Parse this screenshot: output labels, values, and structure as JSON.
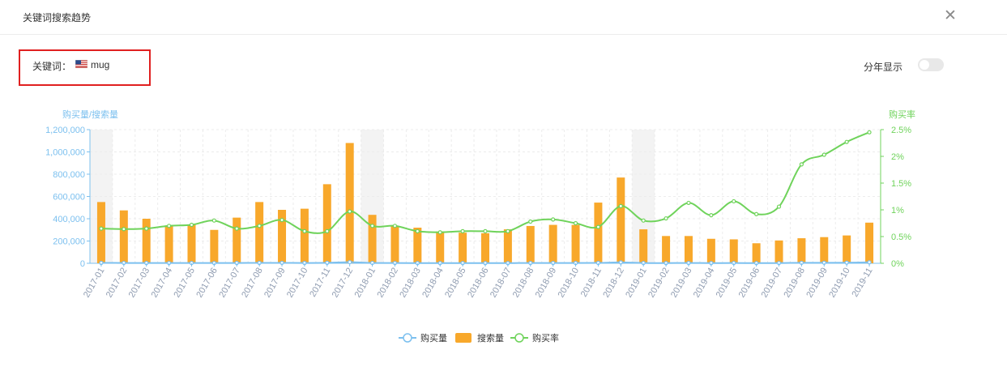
{
  "dialog": {
    "title": "关键词搜索趋势"
  },
  "filter": {
    "keyword_label": "关键词：",
    "keyword_value": "mug",
    "flag_icon": "us-flag-icon",
    "yearly_toggle_label": "分年显示",
    "yearly_toggle_on": false
  },
  "chart_data": {
    "type": "bar",
    "y_left_label": "购买量/搜索量",
    "y_right_label": "购买率",
    "y_left_ticks": [
      "0",
      "200,000",
      "400,000",
      "600,000",
      "800,000",
      "1,000,000",
      "1,200,000"
    ],
    "y_right_ticks": [
      "0%",
      "0.5%",
      "1%",
      "1.5%",
      "2%",
      "2.5%"
    ],
    "ylim_left": [
      0,
      1200000
    ],
    "ylim_right": [
      0,
      2.5
    ],
    "categories": [
      "2017-01",
      "2017-02",
      "2017-03",
      "2017-04",
      "2017-05",
      "2017-06",
      "2017-07",
      "2017-08",
      "2017-09",
      "2017-10",
      "2017-11",
      "2017-12",
      "2018-01",
      "2018-02",
      "2018-03",
      "2018-04",
      "2018-05",
      "2018-06",
      "2018-07",
      "2018-08",
      "2018-09",
      "2018-10",
      "2018-11",
      "2018-12",
      "2019-01",
      "2019-02",
      "2019-03",
      "2019-04",
      "2019-05",
      "2019-06",
      "2019-07",
      "2019-08",
      "2019-09",
      "2019-10",
      "2019-11"
    ],
    "series": [
      {
        "name": "购买量",
        "kind": "line",
        "axis": "left",
        "color": "#7cc0ef",
        "values": [
          3600,
          3100,
          2600,
          2400,
          2500,
          2400,
          2700,
          3800,
          3900,
          2900,
          4300,
          10400,
          3100,
          2400,
          1900,
          1700,
          1700,
          1600,
          1900,
          2700,
          2800,
          2600,
          3700,
          8100,
          2500,
          2000,
          2800,
          2000,
          2500,
          1600,
          2200,
          4200,
          4800,
          5700,
          8900
        ]
      },
      {
        "name": "搜索量",
        "kind": "bar",
        "axis": "left",
        "color": "#f8a82b",
        "values": [
          550000,
          475000,
          400000,
          340000,
          345000,
          300000,
          410000,
          550000,
          480000,
          490000,
          710000,
          1080000,
          435000,
          335000,
          320000,
          285000,
          275000,
          270000,
          305000,
          335000,
          345000,
          345000,
          545000,
          770000,
          305000,
          245000,
          245000,
          220000,
          215000,
          180000,
          205000,
          225000,
          235000,
          250000,
          365000
        ]
      },
      {
        "name": "购买率",
        "kind": "line",
        "axis": "right",
        "color": "#6fd35b",
        "values": [
          0.65,
          0.64,
          0.65,
          0.7,
          0.72,
          0.8,
          0.65,
          0.7,
          0.81,
          0.6,
          0.6,
          0.97,
          0.7,
          0.7,
          0.6,
          0.58,
          0.6,
          0.6,
          0.6,
          0.78,
          0.82,
          0.75,
          0.68,
          1.07,
          0.8,
          0.84,
          1.13,
          0.9,
          1.16,
          0.92,
          1.06,
          1.85,
          2.03,
          2.27,
          2.45
        ]
      }
    ],
    "shaded_categories": [
      "2017-01",
      "2018-01",
      "2019-01"
    ],
    "grid": true,
    "legend_position": "bottom"
  }
}
